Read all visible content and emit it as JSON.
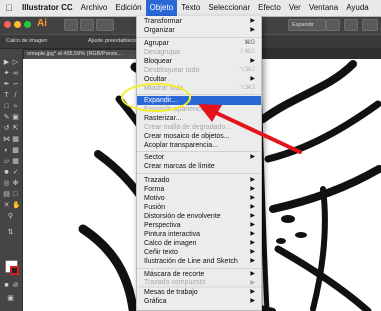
{
  "menubar": {
    "app_name": "Illustrator CC",
    "items": [
      "Archivo",
      "Edición",
      "Objeto",
      "Texto",
      "Seleccionar",
      "Efecto",
      "Ver",
      "Ventana",
      "Ayuda"
    ]
  },
  "appbar": {
    "logo": "Ai",
    "right_label": "Expandir"
  },
  "controlbar": {
    "label": "Calco de imagen",
    "preset": "Ajuste preestablecido:"
  },
  "document": {
    "tab_title": "omaple.jpg* al 495,59% (RGB/Previs..."
  },
  "object_menu": {
    "group1": [
      {
        "label": "Transformar",
        "submenu": true
      },
      {
        "label": "Organizar",
        "submenu": true
      }
    ],
    "group2": [
      {
        "label": "Agrupar",
        "shortcut": "⌘G"
      },
      {
        "label": "Desagrupar",
        "shortcut": "⇧⌘G",
        "disabled": true
      },
      {
        "label": "Bloquear",
        "submenu": true
      },
      {
        "label": "Desbloquear todo",
        "shortcut": "⌥⌘2",
        "disabled": true
      },
      {
        "label": "Ocultar",
        "submenu": true
      },
      {
        "label": "Mostrar todo",
        "shortcut": "⌥⌘3",
        "disabled": true
      }
    ],
    "group3": [
      {
        "label": "Expandir...",
        "highlighted": true
      },
      {
        "label": "Expandir apariencia",
        "disabled": true
      },
      {
        "label": "Rasterizar..."
      },
      {
        "label": "Crear malla de degradado...",
        "disabled": true
      },
      {
        "label": "Crear mosaico de objetos..."
      },
      {
        "label": "Acoplar transparencia..."
      }
    ],
    "group4": [
      {
        "label": "Sector",
        "submenu": true
      },
      {
        "label": "Crear marcas de límite"
      }
    ],
    "group5": [
      {
        "label": "Trazado",
        "submenu": true
      },
      {
        "label": "Forma",
        "submenu": true
      },
      {
        "label": "Motivo",
        "submenu": true
      },
      {
        "label": "Fusión",
        "submenu": true
      },
      {
        "label": "Distorsión de envolvente",
        "submenu": true
      },
      {
        "label": "Perspectiva",
        "submenu": true
      },
      {
        "label": "Pintura interactiva",
        "submenu": true
      },
      {
        "label": "Calco de imagen",
        "submenu": true
      },
      {
        "label": "Ceñir texto",
        "submenu": true
      },
      {
        "label": "Ilustración de Line and Sketch",
        "submenu": true
      }
    ],
    "group6": [
      {
        "label": "Máscara de recorte",
        "submenu": true
      },
      {
        "label": "Trazado compuesto",
        "submenu": true,
        "disabled": true
      },
      {
        "label": "Mesas de trabajo",
        "submenu": true
      },
      {
        "label": "Gráfica",
        "submenu": true
      }
    ]
  },
  "colors": {
    "menu_highlight": "#2a68d8",
    "annotation_circle": "#f4ee27",
    "annotation_arrow": "#e3141b",
    "ai_logo": "#f59a2f"
  }
}
